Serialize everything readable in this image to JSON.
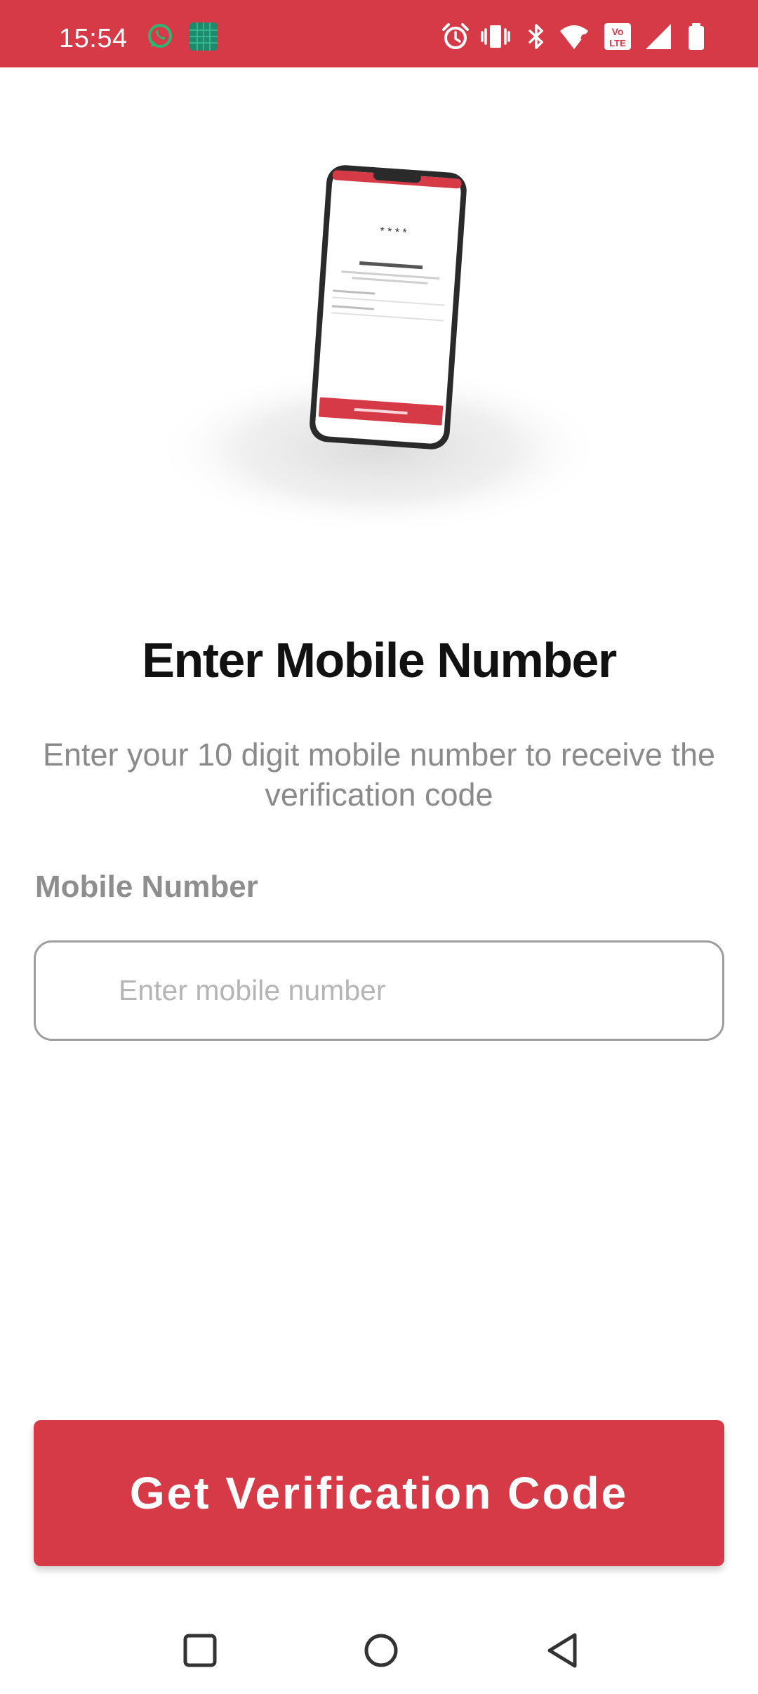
{
  "status_bar": {
    "time": "15:54",
    "background": "#d63a47",
    "left_icons": [
      "whatsapp-icon",
      "app-grid-icon"
    ],
    "right_icons": [
      "alarm-icon",
      "vibrate-icon",
      "bluetooth-icon",
      "wifi-icon",
      "volte-icon",
      "signal-icon",
      "battery-icon"
    ]
  },
  "main": {
    "title": "Enter Mobile Number",
    "subtitle": "Enter your 10 digit mobile number to receive the verification code",
    "field_label": "Mobile Number",
    "field_placeholder": "Enter mobile number",
    "field_value": ""
  },
  "cta": {
    "label": "Get Verification Code",
    "color": "#d63a47"
  },
  "nav_bar": {
    "icons": [
      "recents-icon",
      "home-icon",
      "back-icon"
    ]
  }
}
